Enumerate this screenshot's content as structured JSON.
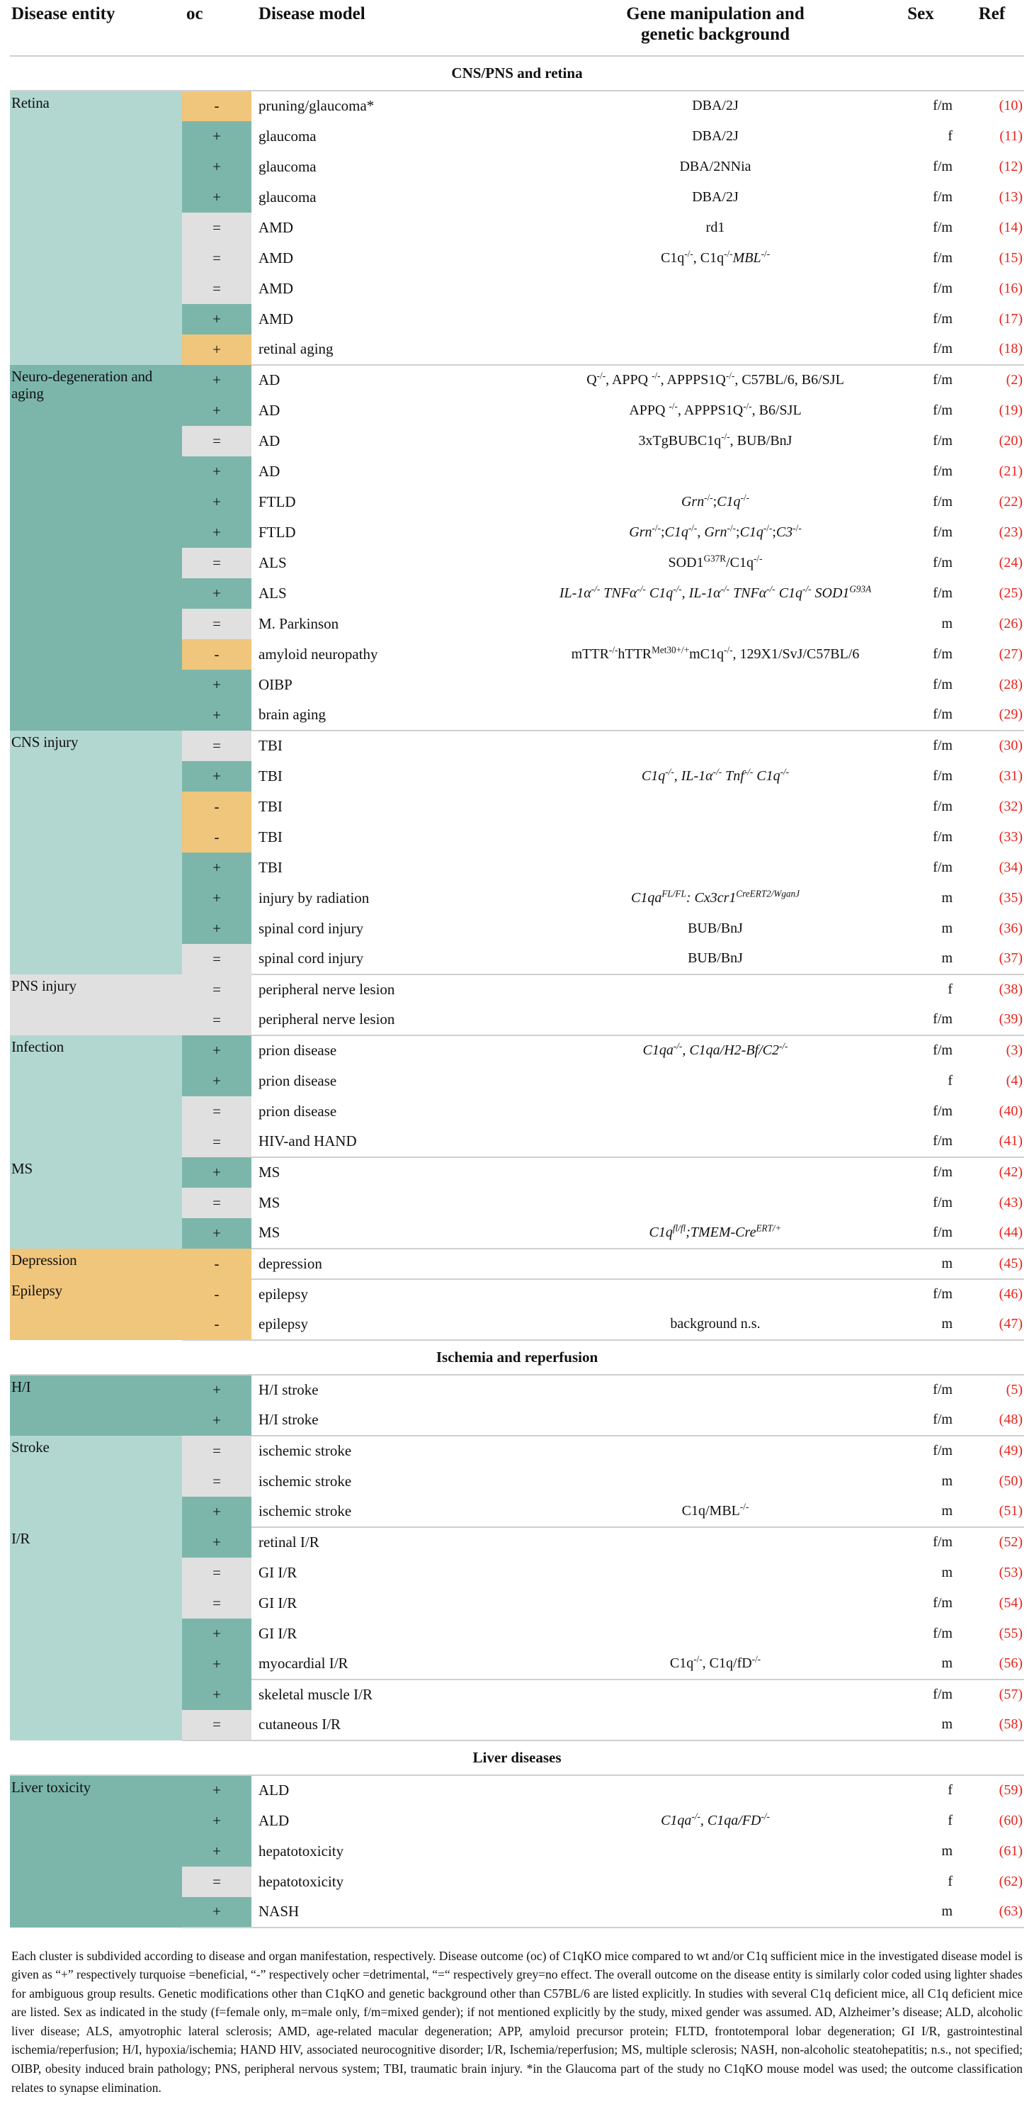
{
  "header": {
    "entity": "Disease entity",
    "oc": "oc",
    "model": "Disease model",
    "gene_line1": "Gene manipulation and",
    "gene_line2": "genetic background",
    "sex": "Sex",
    "ref": "Ref"
  },
  "colors": {
    "turquoise_dark": "#7cb6ab",
    "turquoise_light": "#b2d7d0",
    "ocher": "#f0c57c",
    "grey": "#e0e0e0",
    "ref_red": "#e8221a",
    "rule": "#cfcfcf"
  },
  "sections": [
    {
      "title": "CNS/PNS and retina",
      "groups": [
        {
          "entity": "Retina",
          "entity_color": "turquoise_light",
          "rows": [
            {
              "oc": "-",
              "oc_color": "ocher",
              "model": "pruning/glaucoma*",
              "gene": "DBA/2J",
              "sex": "f/m",
              "ref": "(10)"
            },
            {
              "oc": "+",
              "oc_color": "turquoise_dark",
              "model": "glaucoma",
              "gene": "DBA/2J",
              "sex": "f",
              "ref": "(11)"
            },
            {
              "oc": "+",
              "oc_color": "turquoise_dark",
              "model": "glaucoma",
              "gene": "DBA/2NNia",
              "sex": "f/m",
              "ref": "(12)"
            },
            {
              "oc": "+",
              "oc_color": "turquoise_dark",
              "model": "glaucoma",
              "gene": "DBA/2J",
              "sex": "f/m",
              "ref": "(13)"
            },
            {
              "oc": "=",
              "oc_color": "grey",
              "model": "AMD",
              "gene": "rd1",
              "sex": "f/m",
              "ref": "(14)"
            },
            {
              "oc": "=",
              "oc_color": "grey",
              "model": "AMD",
              "gene_html": "C1q<sup>-/-</sup>, C1q<sup>-/-</sup><i>MBL</i><sup>-/-</sup>",
              "sex": "f/m",
              "ref": "(15)"
            },
            {
              "oc": "=",
              "oc_color": "grey",
              "model": "AMD",
              "gene": "",
              "sex": "f/m",
              "ref": "(16)"
            },
            {
              "oc": "+",
              "oc_color": "turquoise_dark",
              "model": "AMD",
              "gene": "",
              "sex": "f/m",
              "ref": "(17)"
            },
            {
              "oc": "+",
              "oc_color": "ocher",
              "model": "retinal aging",
              "gene": "",
              "sex": "f/m",
              "ref": "(18)"
            }
          ]
        },
        {
          "entity": "Neuro-degeneration and aging",
          "entity_color": "turquoise_dark",
          "rows": [
            {
              "oc": "+",
              "oc_color": "turquoise_dark",
              "model": "AD",
              "gene_html": "Q<sup>-/-</sup>, APPQ <sup>-/-</sup>, APPPS1Q<sup>-/-</sup>, C57BL/6, B6/SJL",
              "sex": "f/m",
              "ref": "(2)"
            },
            {
              "oc": "+",
              "oc_color": "turquoise_dark",
              "model": "AD",
              "gene_html": "APPQ <sup>-/-</sup>, APPPS1Q<sup>-/-</sup>, B6/SJL",
              "sex": "f/m",
              "ref": "(19)"
            },
            {
              "oc": "=",
              "oc_color": "grey",
              "model": "AD",
              "gene_html": "3xTgBUBC1q<sup>-/-</sup>, BUB/BnJ",
              "sex": "f/m",
              "ref": "(20)"
            },
            {
              "oc": "+",
              "oc_color": "turquoise_dark",
              "model": "AD",
              "gene": "",
              "sex": "f/m",
              "ref": "(21)"
            },
            {
              "oc": "+",
              "oc_color": "turquoise_dark",
              "model": "FTLD",
              "gene_html": "<i>Grn</i><sup>-/-</sup>;<i>C1q</i><sup>-/-</sup>",
              "sex": "f/m",
              "ref": "(22)"
            },
            {
              "oc": "+",
              "oc_color": "turquoise_dark",
              "model": "FTLD",
              "gene_html": "<i>Grn</i><sup>-/-</sup>;<i>C1q</i><sup>-/-</sup>, <i>Grn</i><sup>-/-</sup>;<i>C1q</i><sup>-/-</sup>;<i>C3</i><sup>-/-</sup>",
              "sex": "f/m",
              "ref": "(23)"
            },
            {
              "oc": "=",
              "oc_color": "grey",
              "model": "ALS",
              "gene_html": "SOD1<sup>G37R</sup>/C1q<sup>-/-</sup>",
              "sex": "f/m",
              "ref": "(24)"
            },
            {
              "oc": "+",
              "oc_color": "turquoise_dark",
              "model": "ALS",
              "gene_html": "<i>IL-1&alpha;<sup>-/-</sup> TNF&alpha;<sup>-/-</sup> C1q<sup>-/-</sup>, IL-1&alpha;<sup>-/-</sup> TNF&alpha;<sup>-/-</sup> C1q<sup>-/-</sup> SOD1<sup>G93A</sup></i>",
              "sex": "f/m",
              "ref": "(25)"
            },
            {
              "oc": "=",
              "oc_color": "grey",
              "model": "M. Parkinson",
              "gene": "",
              "sex": "m",
              "ref": "(26)"
            },
            {
              "oc": "-",
              "oc_color": "ocher",
              "model": "amyloid neuropathy",
              "gene_html": "mTTR<sup>-/-</sup>hTTR<sup>Met30+/+</sup>mC1q<sup>-/-</sup>, 129X1/SvJ/C57BL/6",
              "sex": "f/m",
              "ref": "(27)"
            },
            {
              "oc": "+",
              "oc_color": "turquoise_dark",
              "model": "OIBP",
              "gene": "",
              "sex": "f/m",
              "ref": "(28)"
            },
            {
              "oc": "+",
              "oc_color": "turquoise_dark",
              "model": "brain aging",
              "gene": "",
              "sex": "f/m",
              "ref": "(29)"
            }
          ]
        },
        {
          "entity": "CNS injury",
          "entity_color": "turquoise_light",
          "rows": [
            {
              "oc": "=",
              "oc_color": "grey",
              "model": "TBI",
              "gene": "",
              "sex": "f/m",
              "ref": "(30)"
            },
            {
              "oc": "+",
              "oc_color": "turquoise_dark",
              "model": "TBI",
              "gene_html": "<i>C1q<sup>-/-</sup>, IL-1&alpha;<sup>-/-</sup> Tnf<sup>-/-</sup> C1q<sup>-/-</sup></i>",
              "sex": "f/m",
              "ref": "(31)"
            },
            {
              "oc": "-",
              "oc_color": "ocher",
              "model": "TBI",
              "gene": "",
              "sex": "f/m",
              "ref": "(32)"
            },
            {
              "oc": "-",
              "oc_color": "ocher",
              "model": "TBI",
              "gene": "",
              "sex": "f/m",
              "ref": "(33)"
            },
            {
              "oc": "+",
              "oc_color": "turquoise_dark",
              "model": "TBI",
              "gene": "",
              "sex": "f/m",
              "ref": "(34)"
            },
            {
              "oc": "+",
              "oc_color": "turquoise_dark",
              "model": "injury by radiation",
              "gene_html": "<i>C1qa<sup>FL/FL</sup>: Cx3cr1<sup>CreERT2/WganJ</sup></i>",
              "sex": "m",
              "ref": "(35)"
            },
            {
              "oc": "+",
              "oc_color": "turquoise_dark",
              "model": "spinal cord injury",
              "gene": "BUB/BnJ",
              "sex": "m",
              "ref": "(36)"
            },
            {
              "oc": "=",
              "oc_color": "grey",
              "model": "spinal cord injury",
              "gene": "BUB/BnJ",
              "sex": "m",
              "ref": "(37)"
            }
          ]
        },
        {
          "entity": "PNS injury",
          "entity_color": "grey",
          "rows": [
            {
              "oc": "=",
              "oc_color": "grey",
              "model": "peripheral nerve lesion",
              "gene": "",
              "sex": "f",
              "ref": "(38)"
            },
            {
              "oc": "=",
              "oc_color": "grey",
              "model": "peripheral nerve lesion",
              "gene": "",
              "sex": "f/m",
              "ref": "(39)"
            }
          ]
        },
        {
          "entity": "Infection",
          "entity_color": "turquoise_light",
          "rows": [
            {
              "oc": "+",
              "oc_color": "turquoise_dark",
              "model": "prion disease",
              "gene_html": "<i>C1qa<sup>-/-</sup>, C1qa/H2-Bf/C2<sup>-/-</sup></i>",
              "sex": "f/m",
              "ref": "(3)"
            },
            {
              "oc": "+",
              "oc_color": "turquoise_dark",
              "model": "prion disease",
              "gene": "",
              "sex": "f",
              "ref": "(4)"
            },
            {
              "oc": "=",
              "oc_color": "grey",
              "model": "prion disease",
              "gene": "",
              "sex": "f/m",
              "ref": "(40)"
            },
            {
              "oc": "=",
              "oc_color": "grey",
              "model": "HIV-and HAND",
              "gene": "",
              "sex": "f/m",
              "ref": "(41)"
            }
          ]
        },
        {
          "entity": "MS",
          "entity_color": "turquoise_light",
          "rows": [
            {
              "oc": "+",
              "oc_color": "turquoise_dark",
              "model": "MS",
              "gene": "",
              "sex": "f/m",
              "ref": "(42)"
            },
            {
              "oc": "=",
              "oc_color": "grey",
              "model": "MS",
              "gene": "",
              "sex": "f/m",
              "ref": "(43)"
            },
            {
              "oc": "+",
              "oc_color": "turquoise_dark",
              "model": "MS",
              "gene_html": "<i>C1q<sup>fl/fl</sup>;TMEM-Cre<sup>ERT/+</sup></i>",
              "sex": "f/m",
              "ref": "(44)"
            }
          ]
        },
        {
          "entity": "Depression",
          "entity_color": "ocher",
          "rows": [
            {
              "oc": "-",
              "oc_color": "ocher",
              "model": "depression",
              "gene": "",
              "sex": "m",
              "ref": "(45)"
            }
          ]
        },
        {
          "entity": "Epilepsy",
          "entity_color": "ocher",
          "rows": [
            {
              "oc": "-",
              "oc_color": "ocher",
              "model": "epilepsy",
              "gene": "",
              "sex": "f/m",
              "ref": "(46)"
            },
            {
              "oc": "-",
              "oc_color": "ocher",
              "model": "epilepsy",
              "gene": "background n.s.",
              "sex": "m",
              "ref": "(47)"
            }
          ]
        }
      ]
    },
    {
      "title": "Ischemia and reperfusion",
      "groups": [
        {
          "entity": "H/I",
          "entity_color": "turquoise_dark",
          "rows": [
            {
              "oc": "+",
              "oc_color": "turquoise_dark",
              "model": "H/I stroke",
              "gene": "",
              "sex": "f/m",
              "ref": "(5)"
            },
            {
              "oc": "+",
              "oc_color": "turquoise_dark",
              "model": "H/I stroke",
              "gene": "",
              "sex": "f/m",
              "ref": "(48)"
            }
          ]
        },
        {
          "entity": "Stroke",
          "entity_color": "turquoise_light",
          "rows": [
            {
              "oc": "=",
              "oc_color": "grey",
              "model": "ischemic stroke",
              "gene": "",
              "sex": "f/m",
              "ref": "(49)"
            },
            {
              "oc": "=",
              "oc_color": "grey",
              "model": "ischemic stroke",
              "gene": "",
              "sex": "m",
              "ref": "(50)"
            },
            {
              "oc": "+",
              "oc_color": "turquoise_dark",
              "model": "ischemic stroke",
              "gene_html": "C1q/MBL<sup>-/-</sup>",
              "sex": "m",
              "ref": "(51)"
            }
          ]
        },
        {
          "entity": "I/R",
          "entity_color": "turquoise_light",
          "rows": [
            {
              "oc": "+",
              "oc_color": "turquoise_dark",
              "model": "retinal I/R",
              "gene": "",
              "sex": "f/m",
              "ref": "(52)"
            },
            {
              "oc": "=",
              "oc_color": "grey",
              "model": "GI I/R",
              "gene": "",
              "sex": "m",
              "ref": "(53)"
            },
            {
              "oc": "=",
              "oc_color": "grey",
              "model": "GI I/R",
              "gene": "",
              "sex": "f/m",
              "ref": "(54)"
            },
            {
              "oc": "+",
              "oc_color": "turquoise_dark",
              "model": "GI I/R",
              "gene": "",
              "sex": "f/m",
              "ref": "(55)"
            },
            {
              "oc": "+",
              "oc_color": "turquoise_dark",
              "model": "myocardial I/R",
              "gene_html": "C1q<sup>-/-</sup>, C1q/fD<sup>-/-</sup>",
              "sex": "m",
              "ref": "(56)"
            }
          ]
        },
        {
          "entity": "",
          "entity_color": "turquoise_light",
          "rows": [
            {
              "oc": "+",
              "oc_color": "turquoise_dark",
              "model": "skeletal muscle I/R",
              "gene": "",
              "sex": "f/m",
              "ref": "(57)"
            },
            {
              "oc": "=",
              "oc_color": "grey",
              "model": "cutaneous I/R",
              "gene": "",
              "sex": "m",
              "ref": "(58)"
            }
          ]
        }
      ]
    },
    {
      "title": "Liver diseases",
      "groups": [
        {
          "entity": "Liver toxicity",
          "entity_color": "turquoise_dark",
          "rows": [
            {
              "oc": "+",
              "oc_color": "turquoise_dark",
              "model": "ALD",
              "gene": "",
              "sex": "f",
              "ref": "(59)"
            },
            {
              "oc": "+",
              "oc_color": "turquoise_dark",
              "model": "ALD",
              "gene_html": "<i>C1qa<sup>-/-</sup>, C1qa/FD<sup>-/-</sup></i>",
              "sex": "f",
              "ref": "(60)"
            },
            {
              "oc": "+",
              "oc_color": "turquoise_dark",
              "model": "hepatotoxicity",
              "gene": "",
              "sex": "m",
              "ref": "(61)"
            },
            {
              "oc": "=",
              "oc_color": "grey",
              "model": "hepatotoxicity",
              "gene": "",
              "sex": "f",
              "ref": "(62)"
            },
            {
              "oc": "+",
              "oc_color": "turquoise_dark",
              "model": "NASH",
              "gene": "",
              "sex": "m",
              "ref": "(63)"
            }
          ]
        }
      ]
    }
  ],
  "footnote": "Each cluster is subdivided according to disease and organ manifestation, respectively. Disease outcome (oc) of C1qKO mice compared to wt and/or C1q sufficient mice in the investigated disease model is given as “+” respectively turquoise =beneficial, “-” respectively ocher =detrimental, “=“ respectively grey=no effect. The overall outcome on the disease entity is similarly color coded using lighter shades for ambiguous group results. Genetic modifications other than C1qKO and genetic background other than C57BL/6 are listed explicitly. In studies with several C1q deficient mice, all C1q deficient mice are listed. Sex as indicated in the study (f=female only, m=male only, f/m=mixed gender); if not mentioned explicitly by the study, mixed gender was assumed. AD, Alzheimer’s disease; ALD, alcoholic liver disease; ALS, amyotrophic lateral sclerosis; AMD, age-related macular degeneration; APP, amyloid precursor protein; FLTD, frontotemporal lobar degeneration; GI I/R, gastrointestinal ischemia/reperfusion; H/I, hypoxia/ischemia; HAND HIV, associated neurocognitive disorder; I/R, Ischemia/reperfusion; MS, multiple sclerosis; NASH, non-alcoholic steatohepatitis; n.s., not specified; OIBP, obesity induced brain pathology; PNS, peripheral nervous system; TBI, traumatic brain injury. *in the Glaucoma part of the study no C1qKO mouse model was used; the outcome classification relates to synapse elimination."
}
